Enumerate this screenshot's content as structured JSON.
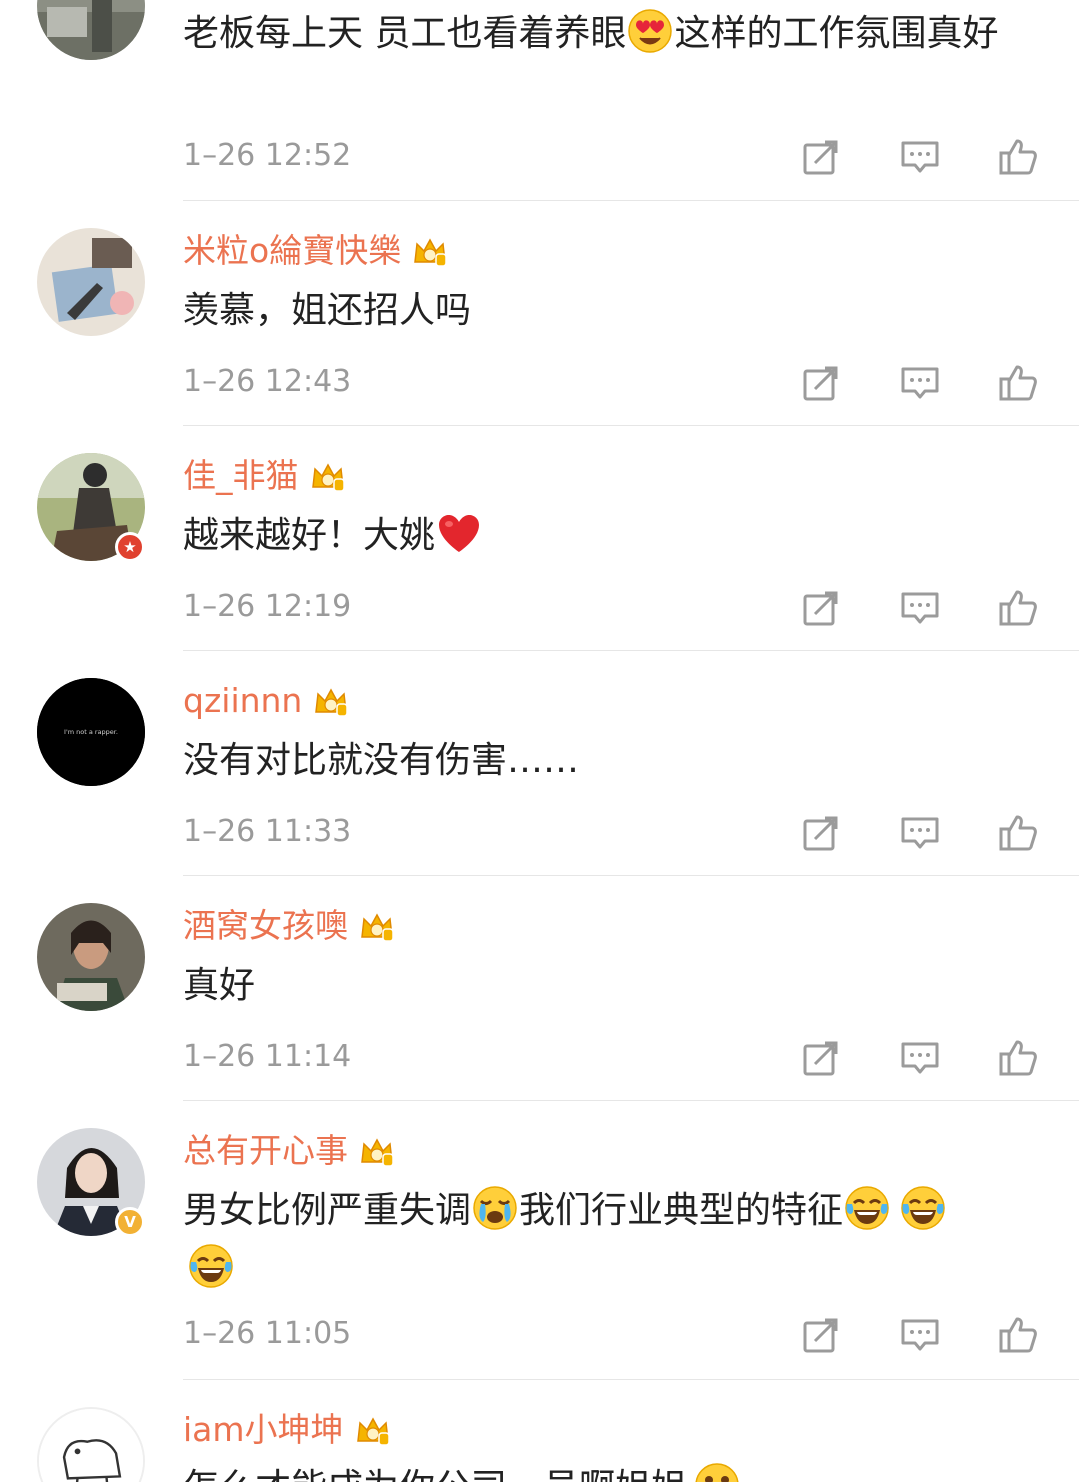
{
  "colors": {
    "username": "#eb7350",
    "text": "#222222",
    "timestamp": "#9a9a9a",
    "icon": "#9b9b9b",
    "divider": "#e6e6e6",
    "crown_gold": "#f5b400",
    "badge_red": "#e0412f",
    "badge_yellow": "#f2b134"
  },
  "actions": {
    "forward_icon": "forward-icon",
    "comment_icon": "comment-icon",
    "like_icon": "like-icon"
  },
  "comments": [
    {
      "username": "",
      "text_parts": [
        "老板每上天 员工也看着养眼",
        "这样的工作氛围真好"
      ],
      "emojis": [
        "heart-eyes-emoji"
      ],
      "time": "1–26 12:52"
    },
    {
      "username": "米粒o綸寶快樂",
      "member_badge": "crown-icon",
      "text": "羡慕，姐还招人吗",
      "time": "1–26 12:43"
    },
    {
      "username": "佳_非猫",
      "member_badge": "crown-icon",
      "verified_badge": "red-star-badge",
      "text": "越来越好！大姚",
      "emojis": [
        "red-heart-emoji"
      ],
      "time": "1–26 12:19"
    },
    {
      "username": "qziinnn",
      "member_badge": "crown-icon",
      "avatar_text": "I'm not a rapper.",
      "text": "没有对比就没有伤害……",
      "time": "1–26 11:33"
    },
    {
      "username": "酒窝女孩噢",
      "member_badge": "crown-icon",
      "text": "真好",
      "time": "1–26 11:14"
    },
    {
      "username": "总有开心事",
      "member_badge": "crown-icon",
      "verified_badge": "yellow-v-badge",
      "verified_letter": "V",
      "text_parts": [
        "男女比例严重失调",
        "我们行业典型的特征"
      ],
      "emojis": [
        "crying-emoji",
        "laugh-cry-emoji",
        "laugh-cry-emoji",
        "laugh-cry-emoji"
      ],
      "time": "1–26 11:05"
    },
    {
      "username": "iam小坤坤",
      "member_badge": "crown-icon",
      "text": "怎么才能成为你公司一员啊姐姐"
    }
  ]
}
